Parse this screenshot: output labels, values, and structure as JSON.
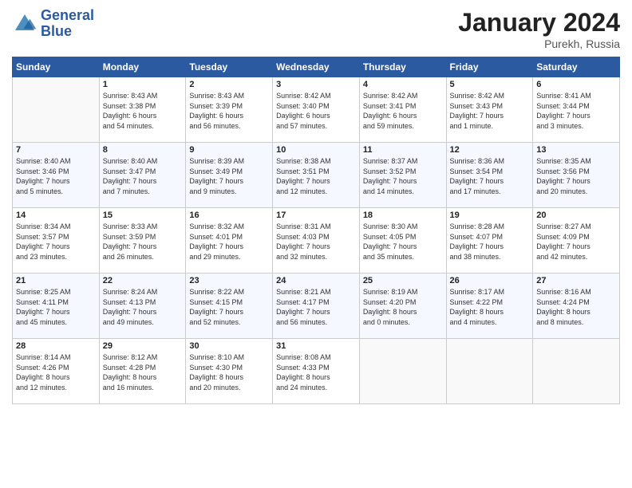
{
  "header": {
    "logo_line1": "General",
    "logo_line2": "Blue",
    "month_title": "January 2024",
    "location": "Purekh, Russia"
  },
  "weekdays": [
    "Sunday",
    "Monday",
    "Tuesday",
    "Wednesday",
    "Thursday",
    "Friday",
    "Saturday"
  ],
  "weeks": [
    [
      {
        "day": "",
        "info": ""
      },
      {
        "day": "1",
        "info": "Sunrise: 8:43 AM\nSunset: 3:38 PM\nDaylight: 6 hours\nand 54 minutes."
      },
      {
        "day": "2",
        "info": "Sunrise: 8:43 AM\nSunset: 3:39 PM\nDaylight: 6 hours\nand 56 minutes."
      },
      {
        "day": "3",
        "info": "Sunrise: 8:42 AM\nSunset: 3:40 PM\nDaylight: 6 hours\nand 57 minutes."
      },
      {
        "day": "4",
        "info": "Sunrise: 8:42 AM\nSunset: 3:41 PM\nDaylight: 6 hours\nand 59 minutes."
      },
      {
        "day": "5",
        "info": "Sunrise: 8:42 AM\nSunset: 3:43 PM\nDaylight: 7 hours\nand 1 minute."
      },
      {
        "day": "6",
        "info": "Sunrise: 8:41 AM\nSunset: 3:44 PM\nDaylight: 7 hours\nand 3 minutes."
      }
    ],
    [
      {
        "day": "7",
        "info": "Sunrise: 8:40 AM\nSunset: 3:46 PM\nDaylight: 7 hours\nand 5 minutes."
      },
      {
        "day": "8",
        "info": "Sunrise: 8:40 AM\nSunset: 3:47 PM\nDaylight: 7 hours\nand 7 minutes."
      },
      {
        "day": "9",
        "info": "Sunrise: 8:39 AM\nSunset: 3:49 PM\nDaylight: 7 hours\nand 9 minutes."
      },
      {
        "day": "10",
        "info": "Sunrise: 8:38 AM\nSunset: 3:51 PM\nDaylight: 7 hours\nand 12 minutes."
      },
      {
        "day": "11",
        "info": "Sunrise: 8:37 AM\nSunset: 3:52 PM\nDaylight: 7 hours\nand 14 minutes."
      },
      {
        "day": "12",
        "info": "Sunrise: 8:36 AM\nSunset: 3:54 PM\nDaylight: 7 hours\nand 17 minutes."
      },
      {
        "day": "13",
        "info": "Sunrise: 8:35 AM\nSunset: 3:56 PM\nDaylight: 7 hours\nand 20 minutes."
      }
    ],
    [
      {
        "day": "14",
        "info": "Sunrise: 8:34 AM\nSunset: 3:57 PM\nDaylight: 7 hours\nand 23 minutes."
      },
      {
        "day": "15",
        "info": "Sunrise: 8:33 AM\nSunset: 3:59 PM\nDaylight: 7 hours\nand 26 minutes."
      },
      {
        "day": "16",
        "info": "Sunrise: 8:32 AM\nSunset: 4:01 PM\nDaylight: 7 hours\nand 29 minutes."
      },
      {
        "day": "17",
        "info": "Sunrise: 8:31 AM\nSunset: 4:03 PM\nDaylight: 7 hours\nand 32 minutes."
      },
      {
        "day": "18",
        "info": "Sunrise: 8:30 AM\nSunset: 4:05 PM\nDaylight: 7 hours\nand 35 minutes."
      },
      {
        "day": "19",
        "info": "Sunrise: 8:28 AM\nSunset: 4:07 PM\nDaylight: 7 hours\nand 38 minutes."
      },
      {
        "day": "20",
        "info": "Sunrise: 8:27 AM\nSunset: 4:09 PM\nDaylight: 7 hours\nand 42 minutes."
      }
    ],
    [
      {
        "day": "21",
        "info": "Sunrise: 8:25 AM\nSunset: 4:11 PM\nDaylight: 7 hours\nand 45 minutes."
      },
      {
        "day": "22",
        "info": "Sunrise: 8:24 AM\nSunset: 4:13 PM\nDaylight: 7 hours\nand 49 minutes."
      },
      {
        "day": "23",
        "info": "Sunrise: 8:22 AM\nSunset: 4:15 PM\nDaylight: 7 hours\nand 52 minutes."
      },
      {
        "day": "24",
        "info": "Sunrise: 8:21 AM\nSunset: 4:17 PM\nDaylight: 7 hours\nand 56 minutes."
      },
      {
        "day": "25",
        "info": "Sunrise: 8:19 AM\nSunset: 4:20 PM\nDaylight: 8 hours\nand 0 minutes."
      },
      {
        "day": "26",
        "info": "Sunrise: 8:17 AM\nSunset: 4:22 PM\nDaylight: 8 hours\nand 4 minutes."
      },
      {
        "day": "27",
        "info": "Sunrise: 8:16 AM\nSunset: 4:24 PM\nDaylight: 8 hours\nand 8 minutes."
      }
    ],
    [
      {
        "day": "28",
        "info": "Sunrise: 8:14 AM\nSunset: 4:26 PM\nDaylight: 8 hours\nand 12 minutes."
      },
      {
        "day": "29",
        "info": "Sunrise: 8:12 AM\nSunset: 4:28 PM\nDaylight: 8 hours\nand 16 minutes."
      },
      {
        "day": "30",
        "info": "Sunrise: 8:10 AM\nSunset: 4:30 PM\nDaylight: 8 hours\nand 20 minutes."
      },
      {
        "day": "31",
        "info": "Sunrise: 8:08 AM\nSunset: 4:33 PM\nDaylight: 8 hours\nand 24 minutes."
      },
      {
        "day": "",
        "info": ""
      },
      {
        "day": "",
        "info": ""
      },
      {
        "day": "",
        "info": ""
      }
    ]
  ]
}
